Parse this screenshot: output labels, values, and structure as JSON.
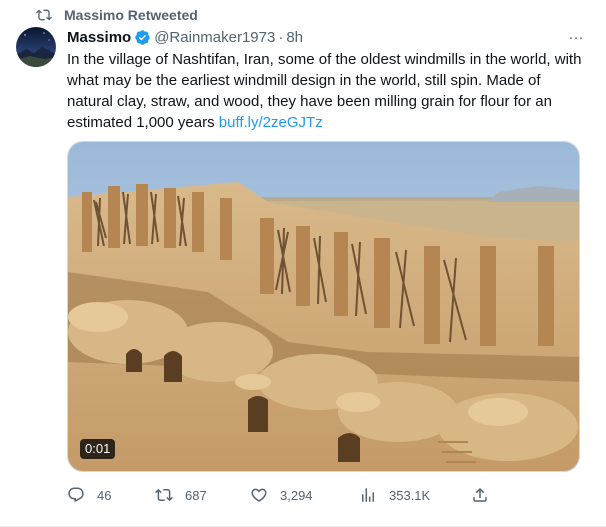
{
  "retweet": {
    "label": "Massimo Retweeted"
  },
  "author": {
    "name": "Massimo",
    "handle": "@Rainmaker1973",
    "separator": "·",
    "time": "8h",
    "more": "···"
  },
  "tweet": {
    "text": "In the village of Nashtifan, Iran, some of the oldest windmills in the world, with what may be the earliest windmill design in the world, still spin. Made of natural clay, straw, and wood, they have been milling grain for flour for an estimated 1,000 years ",
    "link": "buff.ly/2zeGJTz"
  },
  "media": {
    "duration": "0:01"
  },
  "actions": {
    "replies": "46",
    "retweets": "687",
    "likes": "3,294",
    "views": "353.1K"
  },
  "colors": {
    "accent": "#1d9bf0",
    "muted": "#536471",
    "text": "#0f1419"
  },
  "icons": [
    "retweet-icon",
    "verified-badge-icon",
    "more-icon",
    "reply-icon",
    "like-icon",
    "views-icon",
    "share-icon"
  ]
}
